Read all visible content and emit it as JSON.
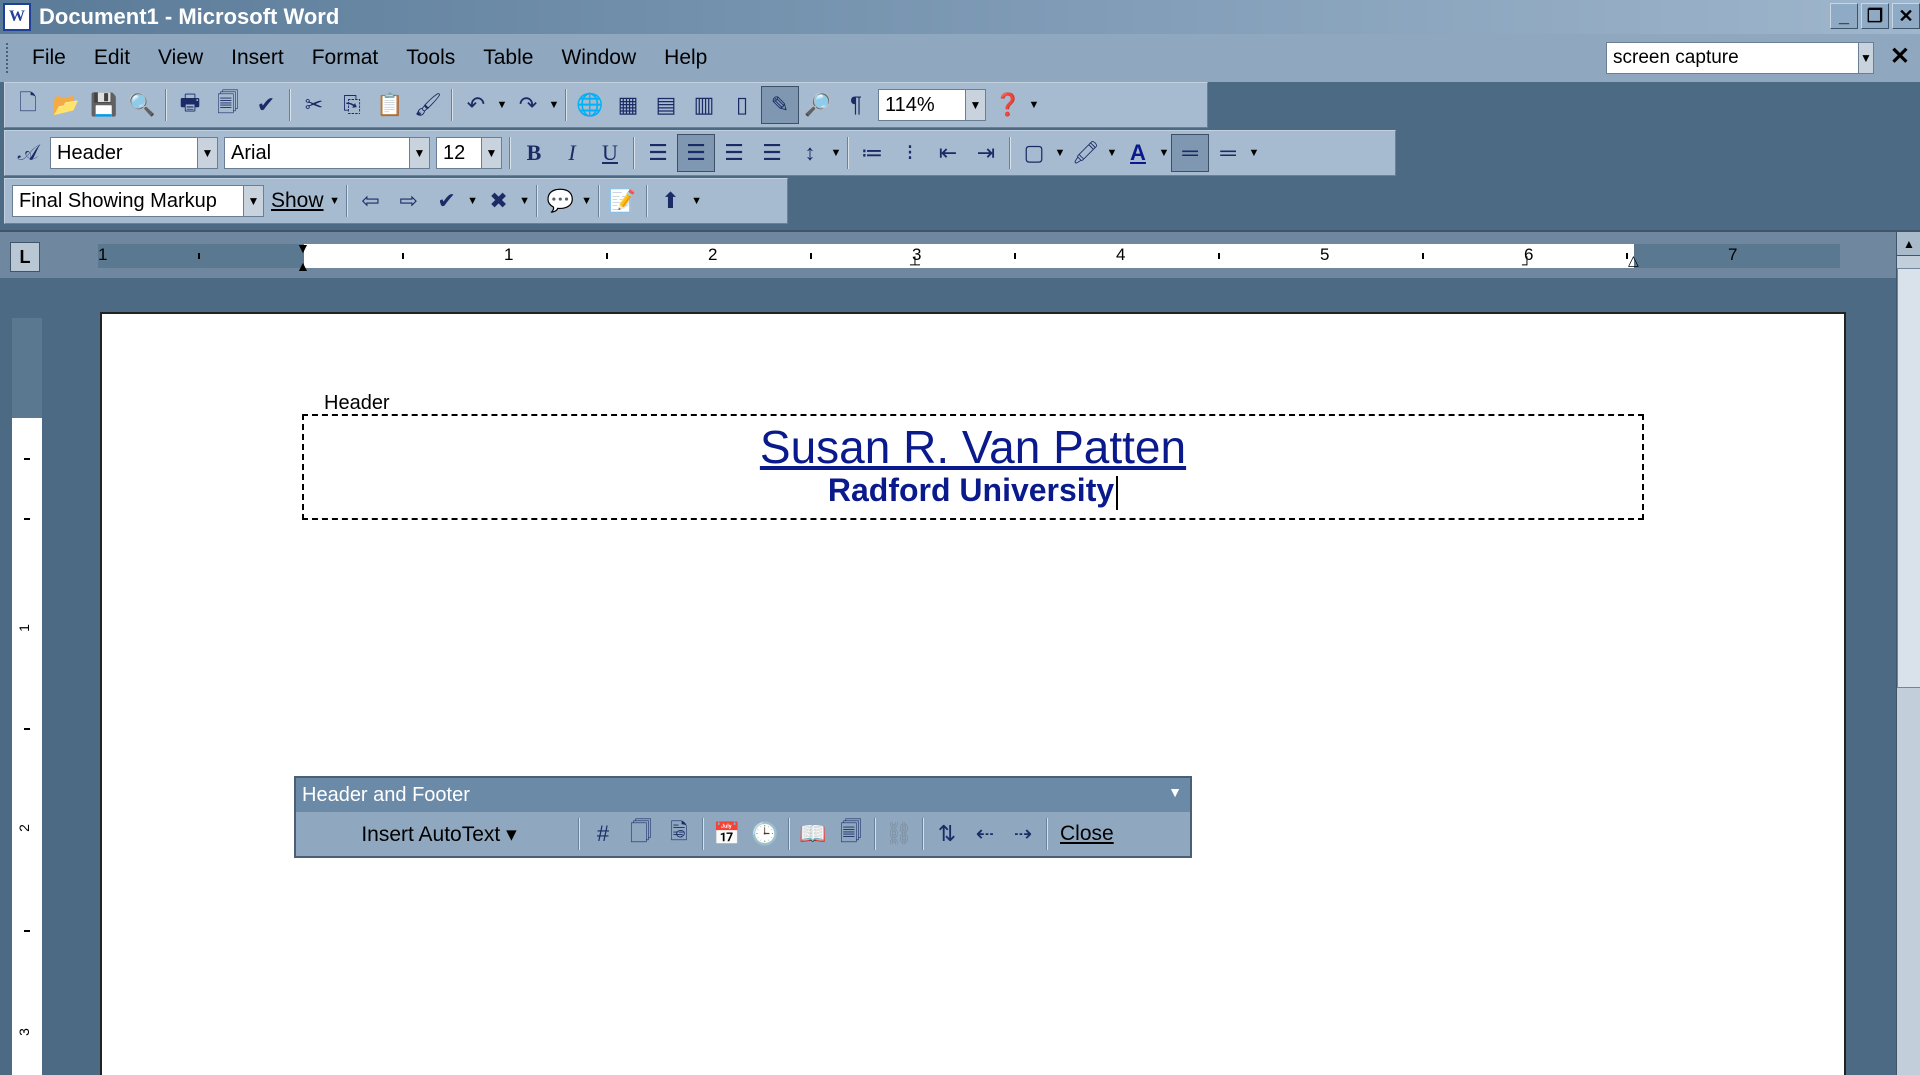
{
  "window": {
    "title": "Document1 - Microsoft Word",
    "icon_letter": "W",
    "controls": [
      "minimize-icon",
      "restore-icon",
      "close-icon"
    ]
  },
  "menu": {
    "items": [
      "File",
      "Edit",
      "View",
      "Insert",
      "Format",
      "Tools",
      "Table",
      "Window",
      "Help"
    ],
    "help_search_value": "screen capture"
  },
  "standard_toolbar": {
    "zoom_value": "114%"
  },
  "formatting_toolbar": {
    "style_value": "Header",
    "font_value": "Arial",
    "size_value": "12"
  },
  "reviewing_toolbar": {
    "display_value": "Final Showing Markup",
    "show_label": "Show"
  },
  "ruler": {
    "numbers": [
      "1",
      "1",
      "2",
      "3",
      "4",
      "5",
      "6",
      "7"
    ],
    "tab_selector": "L",
    "vertical_numbers": [
      "1",
      "2",
      "3"
    ]
  },
  "document": {
    "header_label": "Header",
    "header_line1": "Susan R. Van Patten",
    "header_line2": "Radford University",
    "text_color": "#0a1a8c"
  },
  "header_footer_toolbar": {
    "title": "Header and Footer",
    "insert_autotext_label": "Insert AutoText",
    "close_label": "Close"
  }
}
